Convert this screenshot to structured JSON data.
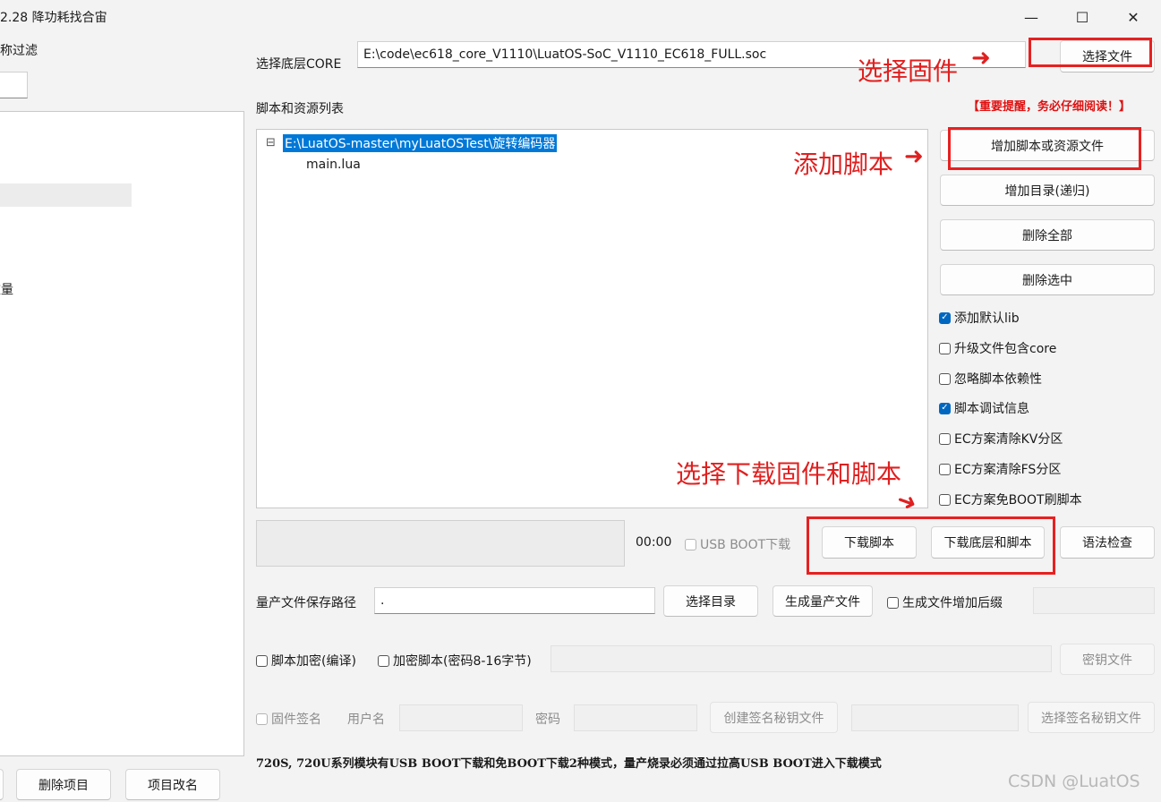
{
  "window": {
    "title": "2.28 降功耗找合宙",
    "min": "—",
    "max": "☐",
    "close": "✕"
  },
  "left": {
    "filter_label": "名称过滤",
    "count_label": "数量",
    "delete_btn": "删除项目",
    "rename_btn": "项目改名"
  },
  "core": {
    "label": "选择底层CORE",
    "value": "E:\\code\\ec618_core_V1110\\LuatOS-SoC_V1110_EC618_FULL.soc",
    "choose_btn": "选择文件"
  },
  "scripts": {
    "label": "脚本和资源列表",
    "notice": "【重要提醒，务必仔细阅读！】",
    "tree_expander": "⊟",
    "tree_root": "E:\\LuatOS-master\\myLuatOSTest\\旋转编码器",
    "tree_child": "main.lua"
  },
  "side_buttons": {
    "add_file": "增加脚本或资源文件",
    "add_dir": "增加目录(递归)",
    "delete_all": "删除全部",
    "delete_sel": "删除选中"
  },
  "options": [
    {
      "label": "添加默认lib",
      "checked": true
    },
    {
      "label": "升级文件包含core",
      "checked": false
    },
    {
      "label": "忽略脚本依赖性",
      "checked": false
    },
    {
      "label": "脚本调试信息",
      "checked": true
    },
    {
      "label": "EC方案清除KV分区",
      "checked": false
    },
    {
      "label": "EC方案清除FS分区",
      "checked": false
    },
    {
      "label": "EC方案免BOOT刷脚本",
      "checked": false
    }
  ],
  "download": {
    "time": "00:00",
    "usb_boot": "USB BOOT下载",
    "download_script": "下载脚本",
    "download_all": "下载底层和脚本",
    "syntax_check": "语法检查"
  },
  "mass": {
    "path_label": "量产文件保存路径",
    "path_value": ".",
    "choose_dir": "选择目录",
    "generate": "生成量产文件",
    "suffix_label": "生成文件增加后缀"
  },
  "encrypt": {
    "compile": "脚本加密(编译)",
    "encrypt_script": "加密脚本(密码8-16字节)",
    "key_file": "密钥文件"
  },
  "sign": {
    "firmware_sign": "固件签名",
    "username": "用户名",
    "password": "密码",
    "create_key": "创建签名秘钥文件",
    "choose_key": "选择签名秘钥文件"
  },
  "footer_note": "720S, 720U系列模块有USB BOOT下载和免BOOT下载2种模式，量产烧录必须通过拉高USB BOOT进入下载模式",
  "watermark": "CSDN @LuatOS",
  "annotations": {
    "choose_firmware": "选择固件",
    "add_script": "添加脚本",
    "choose_download": "选择下载固件和脚本",
    "arrow": "➜"
  },
  "colors": {
    "accent": "#0078d7",
    "annotation_red": "#e02020",
    "notice_red": "#e01010"
  }
}
